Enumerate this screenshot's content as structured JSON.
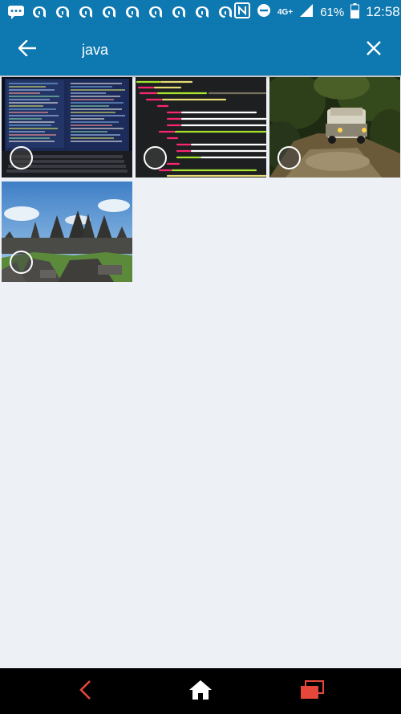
{
  "status_bar": {
    "network": "4G+",
    "battery": "61%",
    "time": "12:58",
    "icons": [
      "message-icon",
      "notification-icon",
      "nfc-icon",
      "do-not-disturb-icon",
      "signal-icon",
      "battery-icon"
    ]
  },
  "search": {
    "query": "java",
    "back_icon": "arrow-left-icon",
    "clear_icon": "close-icon"
  },
  "results": [
    {
      "name": "laptop-code-photo",
      "selected": false
    },
    {
      "name": "html-code-photo",
      "selected": false
    },
    {
      "name": "jungle-jeep-photo",
      "selected": false
    },
    {
      "name": "temple-ruins-photo",
      "selected": false
    }
  ],
  "nav": {
    "back_icon": "nav-back-icon",
    "home_icon": "nav-home-icon",
    "recents_icon": "nav-recents-icon",
    "accent": "#e5473b"
  },
  "colors": {
    "app_bar": "#0e78b0",
    "background": "#edf1f5"
  }
}
